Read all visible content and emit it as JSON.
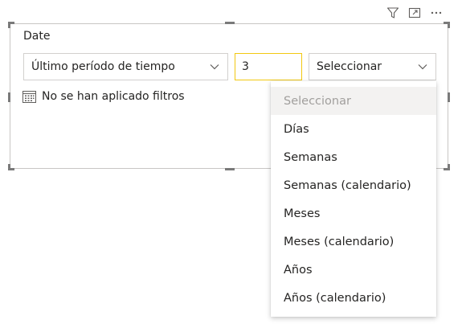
{
  "slicer": {
    "title": "Date",
    "relative_mode": "Último período de tiempo",
    "number_value": "3",
    "unit_selected": "Seleccionar",
    "status_text": "No se han aplicado filtros"
  },
  "header_icons": [
    "filter-icon",
    "focus-mode-icon",
    "more-options-icon"
  ],
  "menu": {
    "items": [
      "Seleccionar",
      "Días",
      "Semanas",
      "Semanas (calendario)",
      "Meses",
      "Meses (calendario)",
      "Años",
      "Años (calendario)"
    ]
  },
  "colors": {
    "input_focus_border": "#f2c811",
    "placeholder_text": "#a19f9d",
    "border": "#c8c6c4"
  }
}
